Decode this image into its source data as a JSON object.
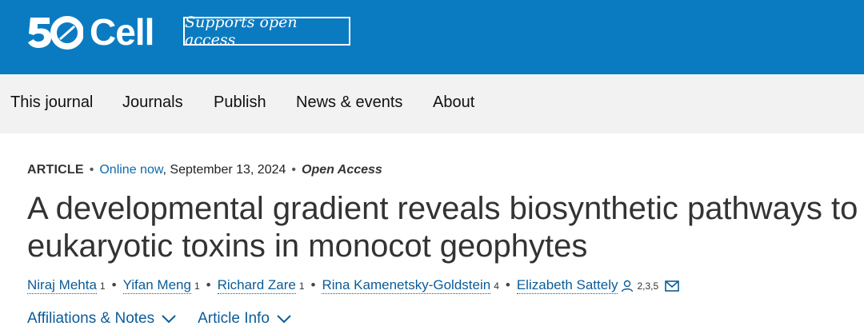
{
  "header": {
    "logo_number": "50",
    "logo_text": "Cell",
    "open_access_label": "Supports open access"
  },
  "nav": {
    "items": [
      {
        "label": "This journal"
      },
      {
        "label": "Journals"
      },
      {
        "label": "Publish"
      },
      {
        "label": "News & events"
      },
      {
        "label": "About"
      }
    ]
  },
  "article": {
    "type": "ARTICLE",
    "online_label": "Online now",
    "date": ", September 13, 2024",
    "access": "Open Access",
    "title_line1": "A developmental gradient reveals biosynthetic pathways to",
    "title_line2": "eukaryotic toxins in monocot geophytes",
    "authors": [
      {
        "name": "Niraj Mehta",
        "affil": "1"
      },
      {
        "name": "Yifan Meng",
        "affil": "1"
      },
      {
        "name": "Richard Zare",
        "affil": "1"
      },
      {
        "name": "Rina Kamenetsky-Goldstein",
        "affil": "4"
      },
      {
        "name": "Elizabeth Sattely",
        "affil": "2,3,5"
      }
    ],
    "affiliations_label": "Affiliations & Notes",
    "article_info_label": "Article Info"
  },
  "colors": {
    "brand_blue": "#0b7bc1",
    "link_blue": "#0b5c99",
    "nav_bg": "#f2f2f2"
  },
  "icons": [
    "person-icon",
    "mail-icon",
    "chevron-down-icon"
  ]
}
